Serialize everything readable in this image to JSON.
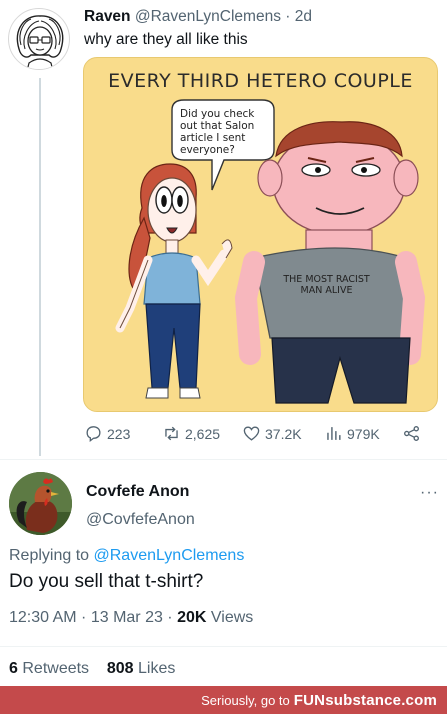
{
  "tweet1": {
    "display_name": "Raven",
    "handle": "@RavenLynClemens",
    "separator": "·",
    "age": "2d",
    "text": "why are they all like this",
    "comic": {
      "title": "EVERY THIRD HETERO COUPLE",
      "speech": "Did you check out that Salon article I sent everyone?",
      "shirt": "THE MOST RACIST MAN ALIVE"
    },
    "actions": {
      "replies": "223",
      "retweets": "2,625",
      "likes": "37.2K",
      "views": "979K"
    }
  },
  "tweet2": {
    "display_name": "Covfefe Anon",
    "handle": "@CovfefeAnon",
    "more": "···",
    "replying_prefix": "Replying to",
    "replying_to": "@RavenLynClemens",
    "text": "Do you sell that t-shirt?",
    "timestamp": "12:30 AM · 13 Mar 23 ·",
    "views_count": "20K",
    "views_label": "Views",
    "retweets_count": "6",
    "retweets_label": "Retweets",
    "likes_count": "808",
    "likes_label": "Likes"
  },
  "watermark": {
    "text": "Seriously, go to",
    "logo": "FUNsubstance.com"
  },
  "colors": {
    "link": "#1d9bf0",
    "muted": "#536471",
    "comic_bg": "#f9dc8b",
    "watermark_bg": "#c44a4b"
  }
}
